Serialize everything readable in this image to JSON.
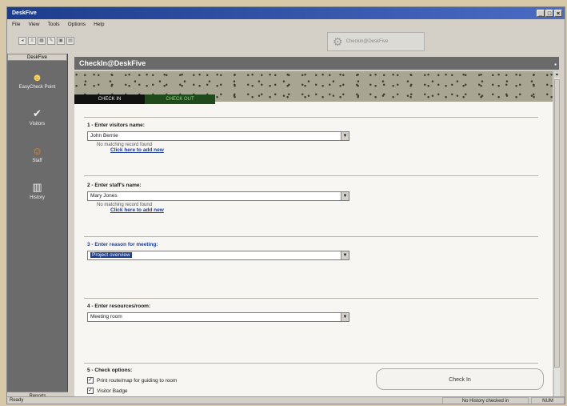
{
  "window": {
    "title": "DeskFive"
  },
  "menu": [
    "File",
    "View",
    "Tools",
    "Options",
    "Help"
  ],
  "toolbar": {
    "gray_button_label": "Checkin@DeskFive"
  },
  "sidebar": {
    "header": "DeskFive",
    "items": [
      {
        "label": "EasyCheck Point",
        "icon": "people-icon"
      },
      {
        "label": "Visitors",
        "icon": "checkmark-person-icon"
      },
      {
        "label": "Staff",
        "icon": "person-icon"
      },
      {
        "label": "History",
        "icon": "book-icon"
      }
    ],
    "footer": "Reports"
  },
  "panel": {
    "title": "CheckIn@DeskFive"
  },
  "tabs": {
    "checkin": "CHECK IN",
    "checkout": "CHECK OUT"
  },
  "form": {
    "visitor": {
      "label": "1 - Enter visitors name:",
      "value": "John Bernie",
      "no_match": "No matching record found",
      "add_link": "Click here to add new"
    },
    "staff": {
      "label": "2 - Enter staff's name:",
      "value": "Mary Jones",
      "no_match": "No matching record found",
      "add_link": "Click here to add new"
    },
    "reason": {
      "label": "3 - Enter reason for meeting:",
      "value": "Project overview"
    },
    "resource": {
      "label": "4 - Enter resources/room:",
      "value": "Meeting room"
    },
    "options": {
      "label": "5 - Check options:",
      "opt1": "Print route/map for guiding to room",
      "opt2": "Visitor Badge",
      "opt1_checked": true,
      "opt2_checked": true
    },
    "checkin_button": "Check In"
  },
  "status": {
    "left": "Ready",
    "mid": "No History checked in",
    "right": "NUM"
  }
}
